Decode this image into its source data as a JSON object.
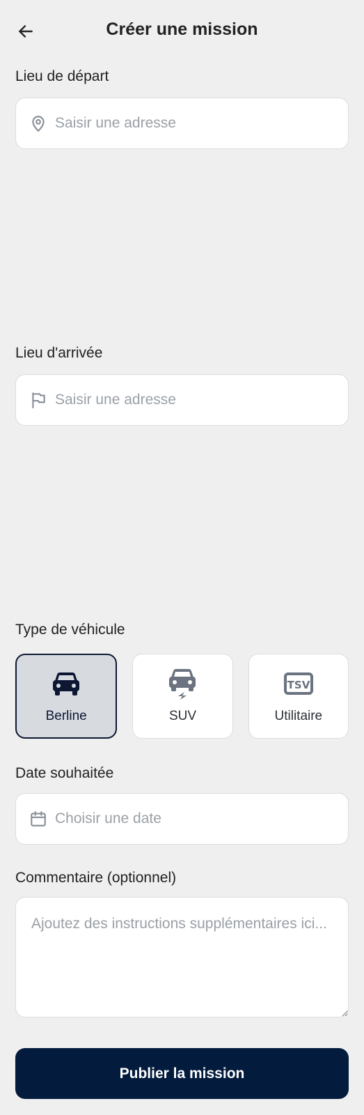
{
  "header": {
    "back_icon": "arrow-left-icon",
    "title": "Créer une mission"
  },
  "departure": {
    "label": "Lieu de départ",
    "placeholder": "Saisir une adresse",
    "value": "",
    "icon": "map-pin-icon"
  },
  "arrival": {
    "label": "Lieu d'arrivée",
    "placeholder": "Saisir une adresse",
    "value": "",
    "icon": "flag-icon"
  },
  "vehicle": {
    "label": "Type de véhicule",
    "selected": "Berline",
    "options": [
      {
        "label": "Berline",
        "icon": "car-icon"
      },
      {
        "label": "SUV",
        "icon": "electric-car-icon"
      },
      {
        "label": "Utilitaire",
        "icon": "tsv-icon"
      }
    ]
  },
  "date": {
    "label": "Date souhaitée",
    "placeholder": "Choisir une date",
    "value": "",
    "icon": "calendar-icon"
  },
  "comment": {
    "label": "Commentaire (optionnel)",
    "placeholder": "Ajoutez des instructions supplémentaires ici...",
    "value": ""
  },
  "submit": {
    "label": "Publier la mission"
  },
  "colors": {
    "background": "#efefef",
    "primary": "#031b3d",
    "selected_card": "#d7dbe0",
    "placeholder": "#9aa0a6"
  }
}
